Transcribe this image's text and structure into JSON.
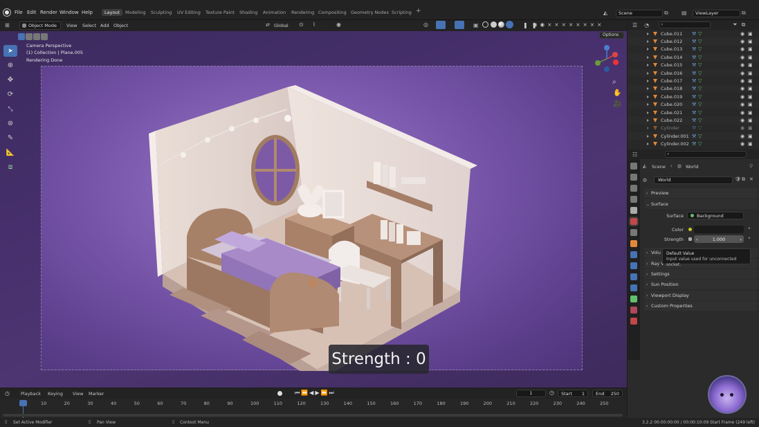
{
  "topbar": {
    "menus": [
      "File",
      "Edit",
      "Render",
      "Window",
      "Help"
    ],
    "workspaces": [
      "Layout",
      "Modeling",
      "Sculpting",
      "UV Editing",
      "Texture Paint",
      "Shading",
      "Animation",
      "Rendering",
      "Compositing",
      "Geometry Nodes",
      "Scripting"
    ],
    "active_workspace": "Layout",
    "add_tab": "+",
    "scene": "Scene",
    "view_layer": "ViewLayer"
  },
  "viewport_header": {
    "mode": "Object Mode",
    "menus": [
      "View",
      "Select",
      "Add",
      "Object"
    ],
    "orientation": "Global",
    "options": "Options"
  },
  "viewport": {
    "camera_label": "Camera Perspective",
    "collection_label": "(1) Collection | Plane.005",
    "render_status": "Rendering Done",
    "popup_text": "Strength : 0",
    "gizmo_axes": [
      "X",
      "Y",
      "Z"
    ]
  },
  "outliner": {
    "items": [
      {
        "name": "Cube.011",
        "dim": false
      },
      {
        "name": "Cube.012",
        "dim": false
      },
      {
        "name": "Cube.013",
        "dim": false
      },
      {
        "name": "Cube.014",
        "dim": false
      },
      {
        "name": "Cube.015",
        "dim": false
      },
      {
        "name": "Cube.016",
        "dim": false
      },
      {
        "name": "Cube.017",
        "dim": false
      },
      {
        "name": "Cube.018",
        "dim": false
      },
      {
        "name": "Cube.019",
        "dim": false
      },
      {
        "name": "Cube.020",
        "dim": false
      },
      {
        "name": "Cube.021",
        "dim": false
      },
      {
        "name": "Cube.022",
        "dim": false
      },
      {
        "name": "Cylinder",
        "dim": true
      },
      {
        "name": "Cylinder.001",
        "dim": false
      },
      {
        "name": "Cylinder.002",
        "dim": false
      }
    ]
  },
  "properties": {
    "breadcrumb_scene": "Scene",
    "breadcrumb_world": "World",
    "world_name": "World",
    "panels": {
      "preview": "Preview",
      "surface": "Surface",
      "volume": "Volu",
      "ray_visibility": "Ray V",
      "settings": "Settings",
      "sun_position": "Sun Position",
      "viewport_display": "Viewport Display",
      "custom_properties": "Custom Properties"
    },
    "surface_label": "Surface",
    "surface_value": "Background",
    "color_label": "Color",
    "strength_label": "Strength",
    "strength_value": "1.000"
  },
  "tooltip": {
    "title": "Default Value",
    "body": "Input value used for unconnected socket."
  },
  "timeline": {
    "menus": [
      "Playback",
      "Keying",
      "View",
      "Marker"
    ],
    "current_frame": "1",
    "start_label": "Start",
    "start_value": "1",
    "end_label": "End",
    "end_value": "250",
    "ticks": [
      "1",
      "10",
      "20",
      "30",
      "40",
      "50",
      "60",
      "70",
      "80",
      "90",
      "100",
      "110",
      "120",
      "130",
      "140",
      "150",
      "160",
      "170",
      "180",
      "190",
      "200",
      "210",
      "220",
      "230",
      "240",
      "250"
    ]
  },
  "statusbar": {
    "left_1": "Set Active Modifier",
    "left_2": "Pan View",
    "left_3": "Context Menu",
    "right": "3.2.2  00:00:00:00 / 00:00:10:09  Start Frame (249 left)"
  },
  "colors": {
    "accent": "#4772b3",
    "viewport_bg": "#4d3572",
    "mesh_icon": "#e2883a",
    "data_icon": "#62c06c"
  }
}
